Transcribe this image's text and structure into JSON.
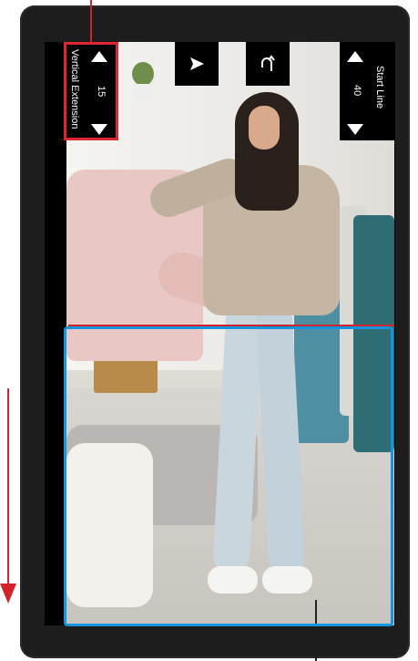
{
  "left_control": {
    "label": "Vertical Extension",
    "value": "15"
  },
  "right_control": {
    "label": "Start Line",
    "value": "40"
  },
  "icons": {
    "send": "send-icon",
    "undo": "undo-icon",
    "up": "triangle-up-icon",
    "down": "triangle-down-icon"
  },
  "colors": {
    "highlight_red": "#e0262f",
    "selection_blue": "#1495dd",
    "device_frame": "#1d1d1d"
  }
}
